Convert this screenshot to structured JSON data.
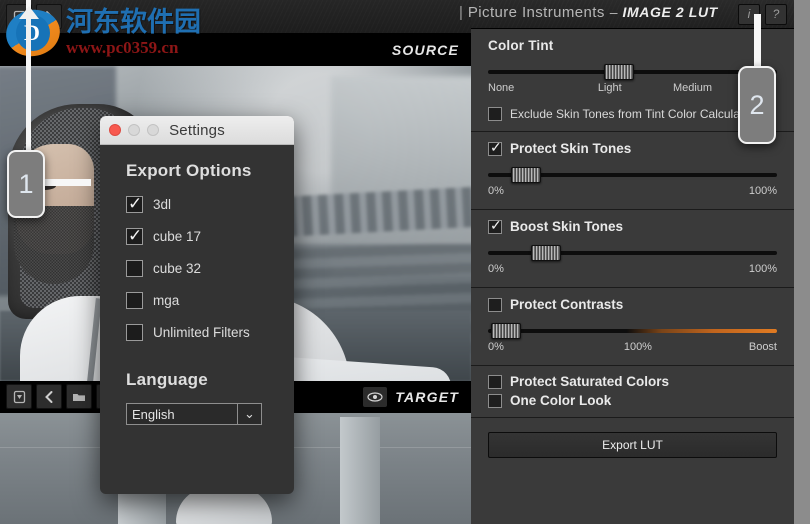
{
  "app": {
    "brand_pipe": "|",
    "brand_name": "Picture Instruments",
    "brand_dash": "–",
    "product": "IMAGE 2 LUT",
    "info_button": "i",
    "help_button": "?"
  },
  "preview": {
    "source_label": "SOURCE",
    "target_label": "TARGET",
    "top_icons": [
      {
        "name": "lut-icon"
      },
      {
        "name": "export-arrow-icon"
      }
    ],
    "bottom_icons": [
      {
        "name": "lut-icon"
      },
      {
        "name": "back-chevron-icon"
      },
      {
        "name": "folder-icon"
      },
      {
        "name": "folder-open-icon"
      }
    ],
    "eye_icon": "eye-icon"
  },
  "panel": {
    "color_tint": {
      "title": "Color Tint",
      "slider": {
        "value_percent": 45,
        "knob_left_percent": 40
      },
      "ticks": [
        "None",
        "Light",
        "Medium"
      ],
      "exclude_checkbox": {
        "label": "Exclude Skin Tones from Tint Color Calculation",
        "checked": false
      }
    },
    "protect_skin_tones": {
      "label": "Protect Skin Tones",
      "checked": true,
      "slider": {
        "knob_left_percent": 8
      },
      "min_label": "0%",
      "max_label": "100%"
    },
    "boost_skin_tones": {
      "label": "Boost Skin Tones",
      "checked": true,
      "slider": {
        "knob_left_percent": 15
      },
      "min_label": "0%",
      "max_label": "100%"
    },
    "protect_contrasts": {
      "label": "Protect Contrasts",
      "checked": false,
      "slider": {
        "knob_left_percent": 1
      },
      "min_label": "0%",
      "mid_label": "100%",
      "max_label": "Boost"
    },
    "protect_saturated_colors": {
      "label": "Protect Saturated Colors",
      "checked": false
    },
    "one_color_look": {
      "label": "One Color Look",
      "checked": false
    },
    "export_button": "Export LUT"
  },
  "settings_dialog": {
    "title": "Settings",
    "export_options_heading": "Export Options",
    "options": [
      {
        "label": "3dl",
        "checked": true
      },
      {
        "label": "cube 17",
        "checked": true
      },
      {
        "label": "cube 32",
        "checked": false
      },
      {
        "label": "mga",
        "checked": false
      },
      {
        "label": "Unlimited Filters",
        "checked": false
      }
    ],
    "language_heading": "Language",
    "language_value": "English",
    "language_arrow": "⌄"
  },
  "callouts": [
    {
      "number": "1"
    },
    {
      "number": "2"
    }
  ],
  "watermark": {
    "site_name": "河东软件园",
    "url": "www.pc0359.cn",
    "logo_letter": "D"
  },
  "colors": {
    "panel_bg": "#3a3a3a",
    "accent_orange": "#e07b22",
    "callout_bg": "#7d7d7d",
    "close_red": "#f8594f"
  }
}
